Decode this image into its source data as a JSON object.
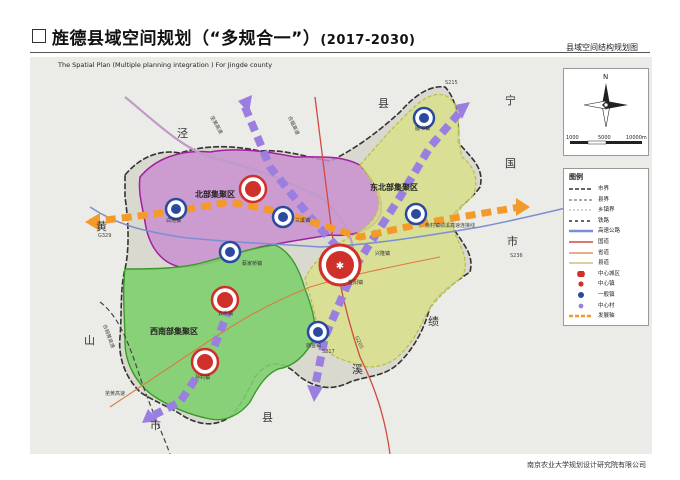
{
  "header": {
    "title_main": "旌德县域空间规划（“多规合一”）",
    "title_years": "(2017-2030)",
    "map_name": "县域空间结构规划图",
    "subtitle_en": "The Spatial Plan (Multiple planning integration ) For Jingde county"
  },
  "credit": "南京农业大学规划设计研究院有限公司",
  "compass": {
    "north_label": "N"
  },
  "scale": {
    "ticks": [
      "1000",
      "5000",
      "10000m"
    ]
  },
  "legend": {
    "title": "图例",
    "items": [
      {
        "label": "市界",
        "symbol": "city-boundary"
      },
      {
        "label": "县界",
        "symbol": "county-boundary"
      },
      {
        "label": "乡镇界",
        "symbol": "township-boundary"
      },
      {
        "label": "铁路",
        "symbol": "railway"
      },
      {
        "label": "高速公路",
        "symbol": "expressway"
      },
      {
        "label": "国道",
        "symbol": "national-road"
      },
      {
        "label": "省道",
        "symbol": "provincial-road"
      },
      {
        "label": "县道",
        "symbol": "county-road"
      },
      {
        "label": "中心城区",
        "symbol": "central-urban-area"
      },
      {
        "label": "中心镇",
        "symbol": "central-town"
      },
      {
        "label": "一般镇",
        "symbol": "general-town"
      },
      {
        "label": "中心村",
        "symbol": "central-village"
      },
      {
        "label": "发展轴",
        "symbol": "development-axis"
      }
    ]
  },
  "map": {
    "zones": [
      {
        "label": "北部集聚区",
        "color": "#c98fd0"
      },
      {
        "label": "东北部集聚区",
        "color": "#d8df8a"
      },
      {
        "label": "西南部集聚区",
        "color": "#7fcf6e"
      }
    ],
    "neighbor_labels": [
      "泾",
      "县",
      "宁",
      "国",
      "市",
      "黄",
      "山",
      "市",
      "绩",
      "溪",
      "县"
    ],
    "road_labels": [
      "芜黄高速",
      "芜黄高速",
      "合铜黄高速",
      "绩溪高速连接线",
      "合福高速",
      "S215",
      "S217",
      "G205",
      "S236",
      "G329"
    ],
    "place_labels": [
      "旌阳镇",
      "兴隆镇",
      "三溪镇",
      "版书镇",
      "白地镇",
      "俞村镇",
      "蔡家桥镇",
      "云乐镇",
      "孙村镇",
      "庙首镇"
    ]
  },
  "colors": {
    "north_zone": "#c98fd0",
    "northeast_zone": "#d8df8a",
    "southwest_zone": "#7fcf6e",
    "axis_purple": "#9b7fe0",
    "axis_orange": "#f39a2b",
    "center_red": "#d0302a",
    "town_blue": "#2a4aa0"
  }
}
